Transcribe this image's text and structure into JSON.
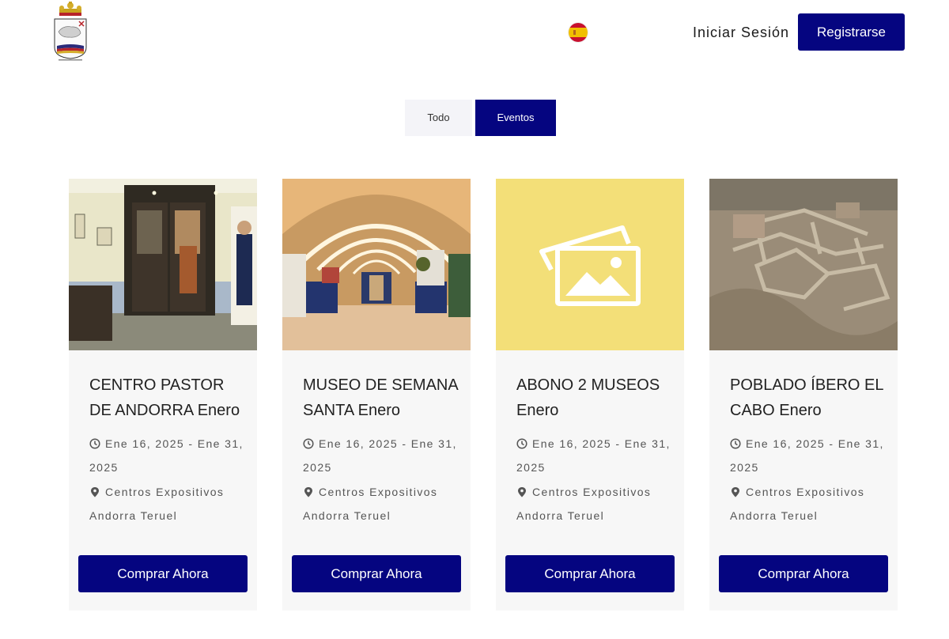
{
  "header": {
    "logo_icon": "coat-of-arms-icon",
    "language_icon": "spain-flag-icon",
    "login_label": "Iniciar Sesión",
    "register_label": "Registrarse"
  },
  "tabs": [
    {
      "label": "Todo",
      "active": false
    },
    {
      "label": "Eventos",
      "active": true
    }
  ],
  "colors": {
    "primary": "#050580",
    "card_bg": "#f7f7f7",
    "placeholder_bg": "#f3df78"
  },
  "events": [
    {
      "title": "CENTRO PASTOR DE ANDORRA Enero",
      "date": "Ene 16, 2025 - Ene 31, 2025",
      "location": "Centros Expositivos Andorra Teruel",
      "image": "museum-entrance-photo",
      "button_label": "Comprar Ahora"
    },
    {
      "title": "MUSEO DE SEMANA SANTA Enero",
      "date": "Ene 16, 2025 - Ene 31, 2025",
      "location": "Centros Expositivos Andorra Teruel",
      "image": "museum-hall-photo",
      "button_label": "Comprar Ahora"
    },
    {
      "title": "ABONO 2 MUSEOS Enero",
      "date": "Ene 16, 2025 - Ene 31, 2025",
      "location": "Centros Expositivos Andorra Teruel",
      "image": "image-placeholder-icon",
      "button_label": "Comprar Ahora"
    },
    {
      "title": "POBLADO ÍBERO EL CABO Enero",
      "date": "Ene 16, 2025 - Ene 31, 2025",
      "location": "Centros Expositivos Andorra Teruel",
      "image": "archaeological-site-photo",
      "button_label": "Comprar Ahora"
    }
  ]
}
